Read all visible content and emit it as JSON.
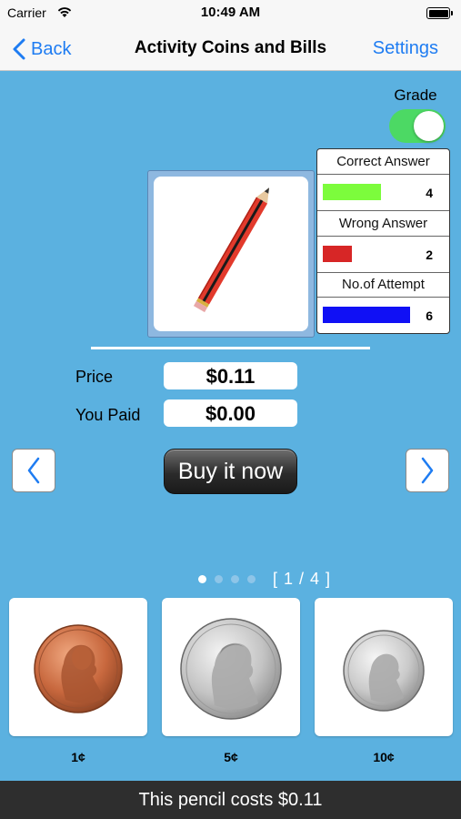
{
  "status_bar": {
    "carrier": "Carrier",
    "time": "10:49 AM"
  },
  "nav": {
    "back_label": "Back",
    "title": "Activity Coins and Bills",
    "settings_label": "Settings"
  },
  "grade": {
    "label": "Grade",
    "enabled": true
  },
  "product": {
    "icon": "pencil-icon"
  },
  "score": {
    "correct": {
      "label": "Correct Answer",
      "value": "4",
      "color": "#7CFC3C"
    },
    "wrong": {
      "label": "Wrong Answer",
      "value": "2",
      "color": "#D72626"
    },
    "attempts": {
      "label": "No.of Attempt",
      "value": "6",
      "color": "#1010F5"
    }
  },
  "price": {
    "label": "Price",
    "value": "$0.11"
  },
  "paid": {
    "label": "You Paid",
    "value": "$0.00"
  },
  "buy_button": {
    "label": "Buy it now"
  },
  "pager": {
    "counter": "[ 1 / 4 ]",
    "total_pages": 4,
    "current_page": 1
  },
  "coins": [
    {
      "label": "1¢",
      "icon": "penny-icon"
    },
    {
      "label": "5¢",
      "icon": "nickel-icon"
    },
    {
      "label": "10¢",
      "icon": "dime-icon"
    }
  ],
  "message": "This pencil costs $0.11",
  "colors": {
    "background": "#5BB1E0",
    "accent": "#1E7CF2",
    "toggle_on": "#4CD964"
  }
}
